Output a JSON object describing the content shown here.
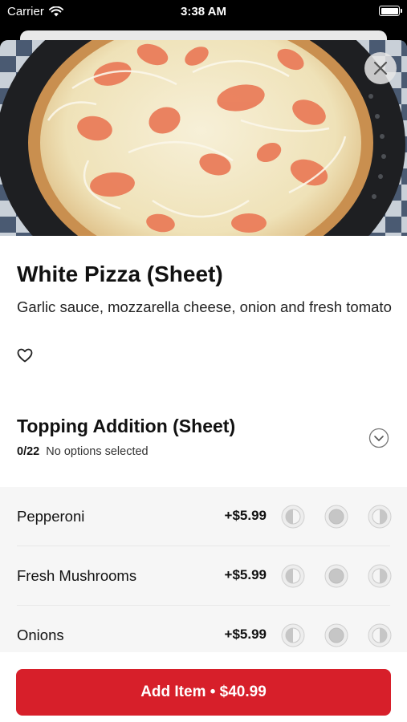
{
  "status_bar": {
    "carrier": "Carrier",
    "time": "3:38 AM"
  },
  "item": {
    "title": "White Pizza (Sheet)",
    "description": "Garlic sauce, mozzarella cheese, onion and fresh tomato",
    "favorite_icon": "heart-outline-icon"
  },
  "section": {
    "title": "Topping Addition (Sheet)",
    "selected_count": "0/22",
    "selected_text": "No options selected",
    "chevron_icon": "chevron-down-circle-icon"
  },
  "options": [
    {
      "name": "Pepperoni",
      "price": "+$5.99"
    },
    {
      "name": "Fresh Mushrooms",
      "price": "+$5.99"
    },
    {
      "name": "Onions",
      "price": "+$5.99"
    }
  ],
  "footer": {
    "add_button_label": "Add Item • $40.99"
  },
  "colors": {
    "accent": "#d71f2a",
    "options_background": "#f6f6f6"
  }
}
